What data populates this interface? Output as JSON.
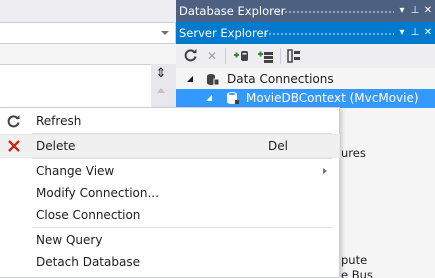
{
  "panels": {
    "database_explorer": {
      "title": "Database Explorer"
    },
    "server_explorer": {
      "title": "Server Explorer"
    }
  },
  "panel_buttons": {
    "dropdown": "▾",
    "pin": "⊥",
    "close": "✕"
  },
  "tree": {
    "data_connections": "Data Connections",
    "connection": "MovieDBContext (MvcMovie)"
  },
  "peek_text": {
    "line1": "ures",
    "line2": "pute",
    "line3": "e Bus"
  },
  "context_menu": {
    "items": [
      {
        "label": "Refresh",
        "icon": "refresh-icon"
      },
      {
        "label": "Delete",
        "shortcut": "Del",
        "icon": "delete-x-icon"
      },
      {
        "label": "Change View",
        "submenu": true
      },
      {
        "label": "Modify Connection..."
      },
      {
        "label": "Close Connection"
      },
      {
        "label": "New Query"
      },
      {
        "label": "Detach Database"
      }
    ]
  },
  "colors": {
    "db_title_bg": "#4d6082",
    "server_title_bg": "#007acc",
    "selection": "#3399ff",
    "delete_icon": "#c42b1c"
  }
}
